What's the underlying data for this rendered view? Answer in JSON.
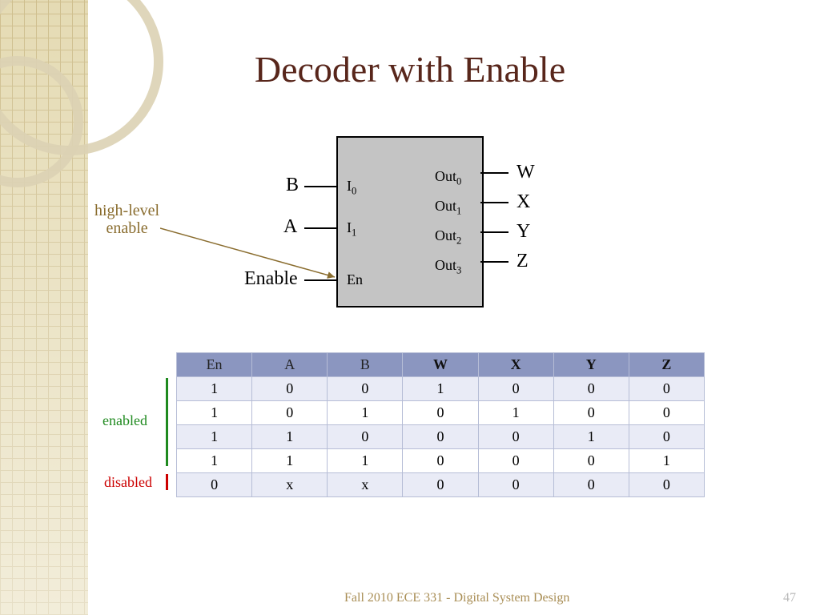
{
  "title": "Decoder with Enable",
  "annotation": {
    "line1": "high-level",
    "line2": "enable"
  },
  "inputs": {
    "ext": [
      "B",
      "A",
      "Enable"
    ],
    "int": [
      "I",
      "I",
      "En"
    ],
    "int_sub": [
      "0",
      "1",
      ""
    ]
  },
  "outputs": {
    "int": [
      "Out",
      "Out",
      "Out",
      "Out"
    ],
    "int_sub": [
      "0",
      "1",
      "2",
      "3"
    ],
    "ext": [
      "W",
      "X",
      "Y",
      "Z"
    ]
  },
  "table": {
    "headers_plain": [
      "En",
      "A",
      "B"
    ],
    "headers_bold": [
      "W",
      "X",
      "Y",
      "Z"
    ],
    "rows": [
      [
        "1",
        "0",
        "0",
        "1",
        "0",
        "0",
        "0"
      ],
      [
        "1",
        "0",
        "1",
        "0",
        "1",
        "0",
        "0"
      ],
      [
        "1",
        "1",
        "0",
        "0",
        "0",
        "1",
        "0"
      ],
      [
        "1",
        "1",
        "1",
        "0",
        "0",
        "0",
        "1"
      ],
      [
        "0",
        "x",
        "x",
        "0",
        "0",
        "0",
        "0"
      ]
    ]
  },
  "labels": {
    "enabled": "enabled",
    "disabled": "disabled"
  },
  "footer": {
    "left": "Fall 2010    ECE 331 - Digital System Design",
    "page": "47"
  }
}
